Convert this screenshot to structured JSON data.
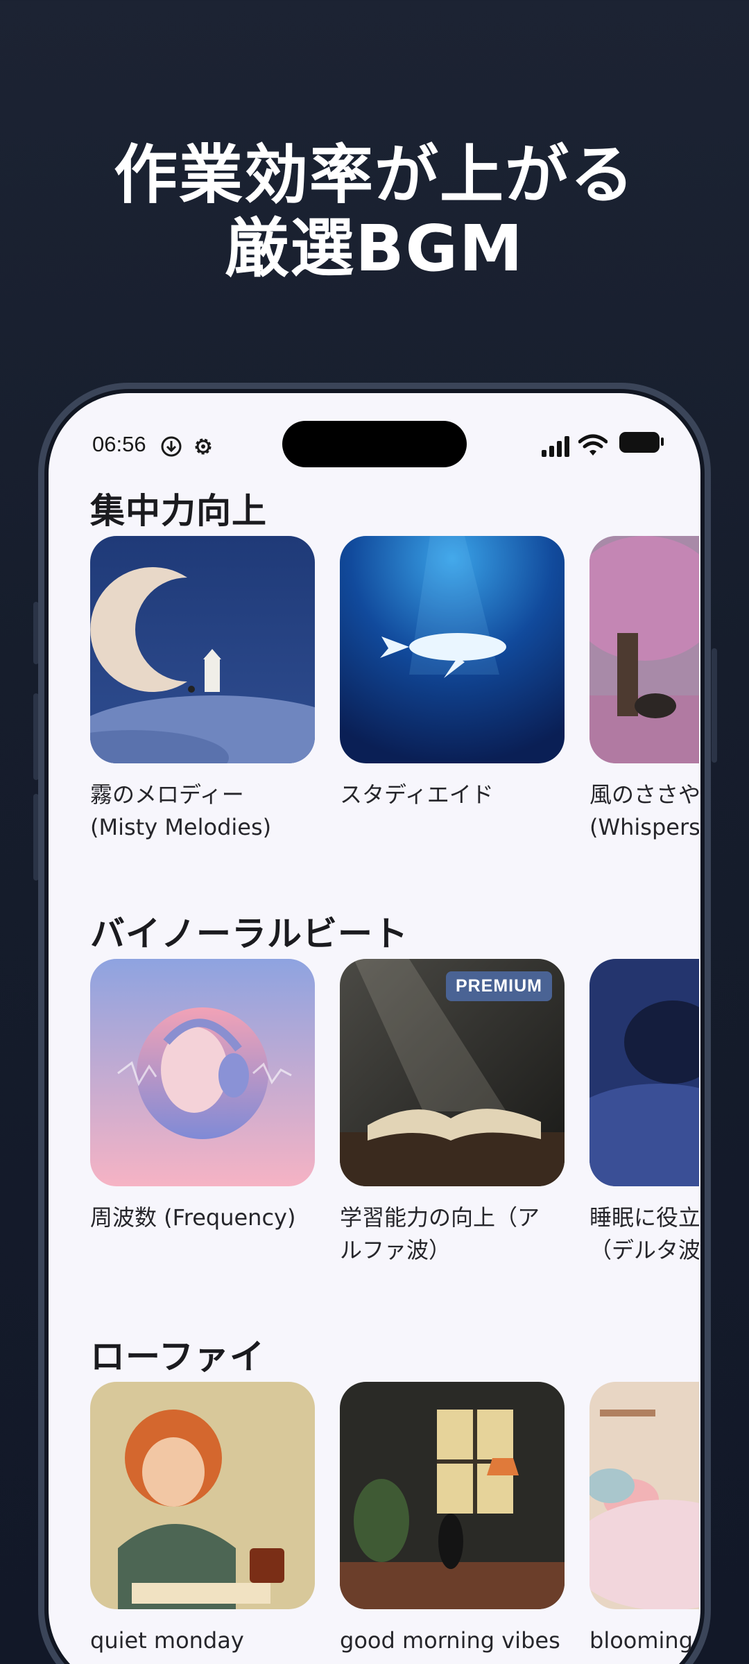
{
  "headline": {
    "line1": "作業効率が上がる",
    "line2": "厳選BGM"
  },
  "status_bar": {
    "time": "06:56"
  },
  "colors": {
    "background": "#1c2333",
    "screen": "#f7f6fc",
    "premium_badge": "#4a6394",
    "title_text": "#1b1b1f"
  },
  "sections": [
    {
      "title": "集中力向上",
      "cards": [
        {
          "label": "霧のメロディー\n(Misty Melodies)",
          "art": "moon-night"
        },
        {
          "label": "スタディエイド",
          "art": "whale-ocean"
        },
        {
          "label": "風のささや\n(Whispers",
          "art": "cherry-tree"
        }
      ]
    },
    {
      "title": "バイノーラルビート",
      "cards": [
        {
          "label": "周波数 (Frequency)",
          "art": "headphone-face"
        },
        {
          "label": "学習能力の向上（ア\nルファ波）",
          "art": "open-book",
          "badge": "PREMIUM"
        },
        {
          "label": "睡眠に役立\n（デルタ波",
          "art": "sleeping-person"
        }
      ]
    },
    {
      "title": "ローファイ",
      "cards": [
        {
          "label": "quiet monday",
          "art": "girl-writing"
        },
        {
          "label": "good morning vibes",
          "art": "lofi-room"
        },
        {
          "label": "blooming i",
          "art": "pastel-bedroom"
        }
      ]
    }
  ]
}
